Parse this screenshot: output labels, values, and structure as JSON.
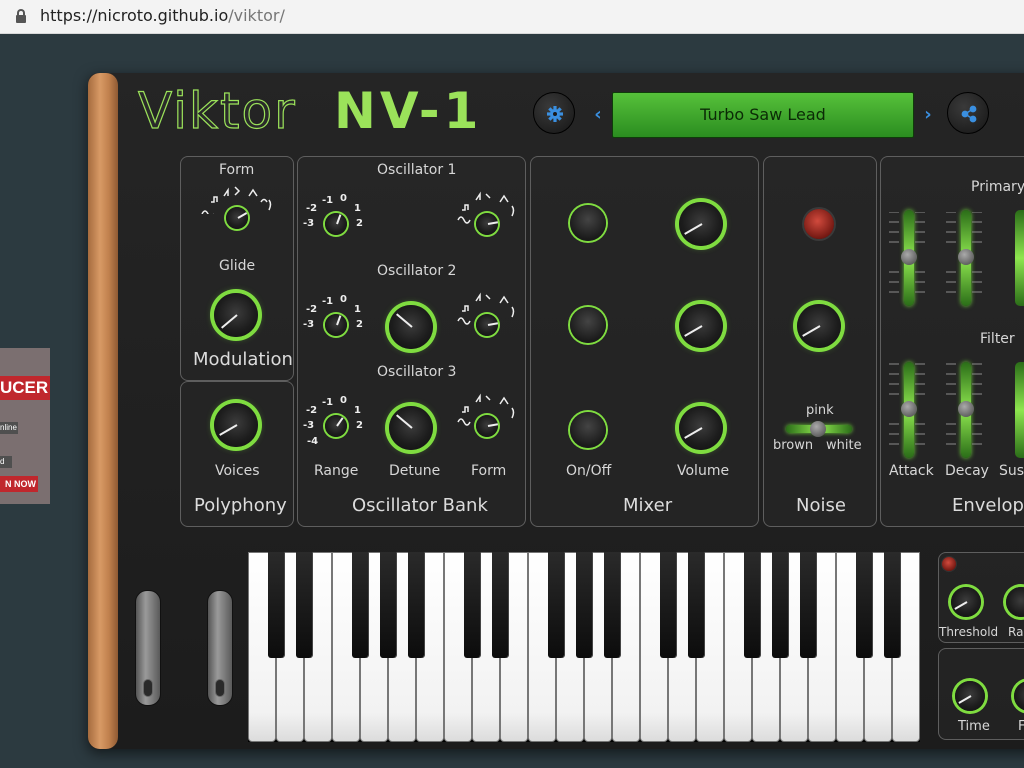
{
  "browser": {
    "url_host": "https://nicroto.github.io",
    "url_path": "/viktor/"
  },
  "ad": {
    "headline": "UCER",
    "line1": "nline",
    "line2": "d",
    "cta": "N NOW"
  },
  "header": {
    "logo_name": "Viktor",
    "logo_model": "NV-1",
    "preset_name": "Turbo Saw Lead",
    "prev_arrow": "‹",
    "next_arrow": "›"
  },
  "modulation": {
    "form_label": "Form",
    "glide_label": "Glide",
    "title": "Modulation"
  },
  "polyphony": {
    "voices_label": "Voices",
    "title": "Polyphony"
  },
  "oscillator_bank": {
    "title": "Oscillator Bank",
    "osc1_label": "Oscillator 1",
    "osc2_label": "Oscillator 2",
    "osc3_label": "Oscillator 3",
    "range_label": "Range",
    "detune_label": "Detune",
    "form_label": "Form",
    "range_marks": [
      "-2",
      "-1",
      "0",
      "1",
      "-3",
      "2",
      "-4"
    ]
  },
  "mixer": {
    "onoff_label": "On/Off",
    "volume_label": "Volume",
    "title": "Mixer"
  },
  "noise": {
    "pink_label": "pink",
    "brown_label": "brown",
    "white_label": "white",
    "title": "Noise"
  },
  "envelopes": {
    "primary_label": "Primary",
    "filter_label": "Filter",
    "attack_label": "Attack",
    "decay_label": "Decay",
    "sustain_label": "Sus",
    "title": "Envelope"
  },
  "compressor": {
    "threshold_label": "Threshold",
    "ratio_label": "Ra"
  },
  "delay": {
    "time_label": "Time",
    "f_label": "F"
  }
}
